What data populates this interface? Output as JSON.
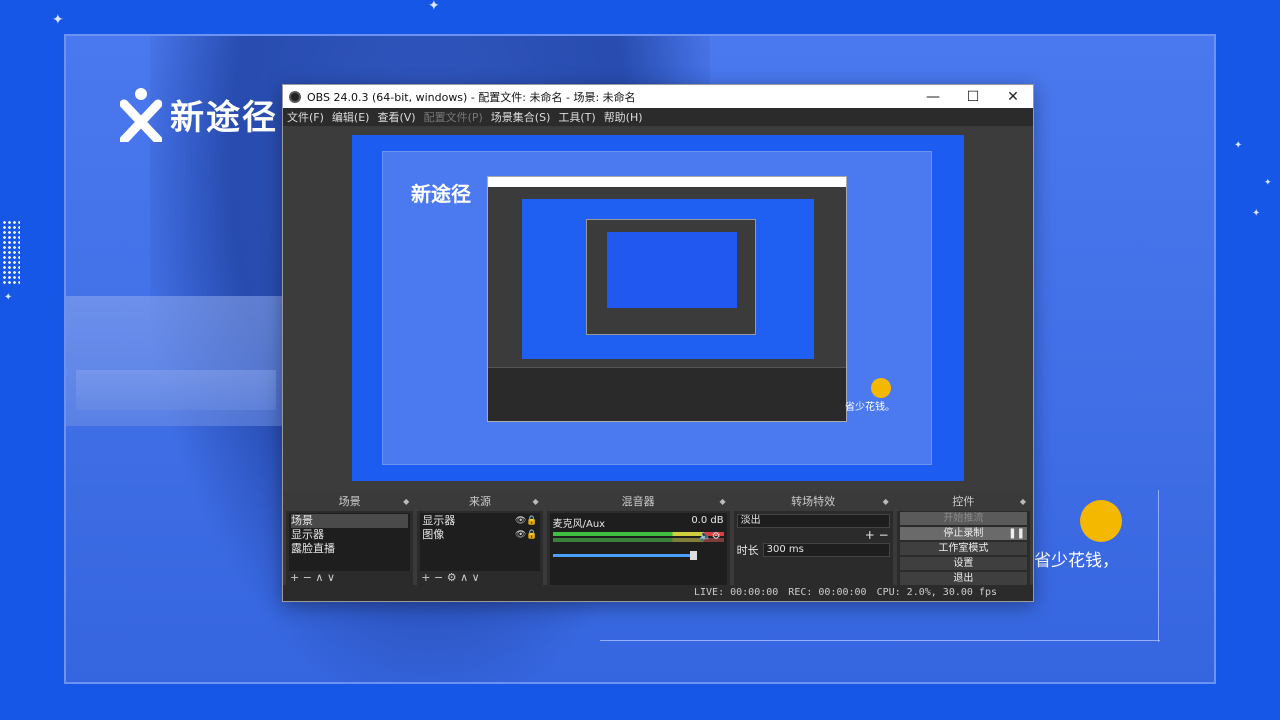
{
  "background": {
    "brand_text": "新途径",
    "caption": "省少花钱，"
  },
  "window": {
    "title": "OBS 24.0.3 (64-bit, windows) - 配置文件: 未命名 - 场景: 未命名",
    "minimize": "—",
    "maximize": "☐",
    "close": "✕"
  },
  "menu": [
    {
      "label": "文件(F)"
    },
    {
      "label": "编辑(E)"
    },
    {
      "label": "查看(V)"
    },
    {
      "label": "配置文件(P)"
    },
    {
      "label": "场景集合(S)"
    },
    {
      "label": "工具(T)"
    },
    {
      "label": "帮助(H)"
    }
  ],
  "preview": {
    "brand_text": "新途径",
    "caption": "省少花钱。"
  },
  "docks": {
    "scenes": {
      "title": "场景",
      "items": [
        "场景",
        "显示器",
        "露脸直播"
      ],
      "toolbar": "+ −   ∧ ∨"
    },
    "sources": {
      "title": "来源",
      "items": [
        "显示器",
        "图像"
      ],
      "toolbar": "+ − ⚙  ∧ ∨"
    },
    "mixer": {
      "title": "混音器",
      "channel": "麦克风/Aux",
      "level": "0.0 dB"
    },
    "transitions": {
      "title": "转场特效",
      "selected": "淡出",
      "add_remove": "+ −",
      "duration_label": "时长",
      "duration_value": "300 ms"
    },
    "controls": {
      "title": "控件",
      "buttons": [
        "开始推流",
        "停止录制",
        "工作室模式",
        "设置",
        "退出"
      ]
    }
  },
  "status": {
    "live": "LIVE: 00:00:00",
    "rec": "REC: 00:00:00",
    "cpu": "CPU: 2.0%, 30.00 fps"
  },
  "colors": {
    "accent_blue": "#1757e8",
    "yellow_dot": "#f5b800",
    "obs_dark": "#2b2b2b"
  }
}
